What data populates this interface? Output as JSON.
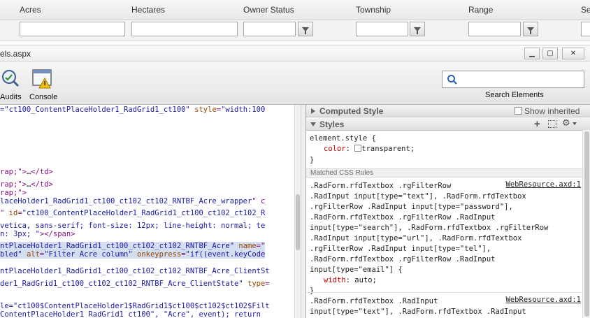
{
  "grid": {
    "columns": [
      "Acres",
      "Hectares",
      "Owner Status",
      "Township",
      "Range",
      "Se"
    ]
  },
  "devtools": {
    "title": "els.aspx",
    "window_buttons": [
      "minimize",
      "restore",
      "close"
    ],
    "toolbar": {
      "audits_label": "Audits",
      "console_label": "Console",
      "search_placeholder": "",
      "search_caption": "Search Elements"
    },
    "dom_lines": [
      {
        "parts": [
          [
            "v",
            "=\"ct100_ContentPlaceHolder1_RadGrid1_ct100\" "
          ],
          [
            "n",
            "style"
          ],
          [
            "t",
            "="
          ],
          [
            "v",
            "\"width:100"
          ]
        ]
      },
      {
        "parts": [
          [
            "t",
            "rap;\">"
          ],
          [
            "x",
            "…"
          ],
          [
            "t",
            "</td>"
          ]
        ]
      },
      {
        "parts": [
          [
            "t",
            "rap;\">"
          ],
          [
            "x",
            "…"
          ],
          [
            "t",
            "</td>"
          ]
        ]
      },
      {
        "parts": [
          [
            "t",
            "rap;\">"
          ]
        ]
      },
      {
        "parts": [
          [
            "v",
            "laceHolder1_RadGrid1_ct100_ct102_ct102_RNTBF_Acre_wrapper"
          ],
          [
            "t",
            "\" c"
          ]
        ]
      },
      {
        "parts": [
          [
            "t",
            "\" "
          ],
          [
            "n",
            "id"
          ],
          [
            "t",
            "="
          ],
          [
            "v",
            "\"ct100_ContentPlaceHolder1_RadGrid1_ct100_ct102_ct102_R"
          ]
        ]
      },
      {
        "parts": [
          [
            "v",
            "vetica, sans-serif; font-size: 12px; line-height: normal; te"
          ]
        ]
      },
      {
        "parts": [
          [
            "v",
            "n: 3px; \""
          ],
          [
            "t",
            "></span>"
          ]
        ]
      },
      {
        "parts": [
          [
            "v",
            "ntPlaceHolder1_RadGrid1_ct100_ct102_ct102_RNTBF_Acre\" "
          ],
          [
            "n",
            "name"
          ],
          [
            "t",
            "=\""
          ]
        ]
      },
      {
        "parts": [
          [
            "v",
            "bled\" "
          ],
          [
            "n",
            "alt"
          ],
          [
            "t",
            "="
          ],
          [
            "v",
            "\"Filter Acre column\" "
          ],
          [
            "n",
            "onkeypress"
          ],
          [
            "t",
            "="
          ],
          [
            "v",
            "\"if((event.keyCode"
          ]
        ]
      },
      {
        "parts": [
          [
            "v",
            "ntPlaceHolder1_RadGrid1_ct100_ct102_ct102_RNTBF_Acre_ClientSt"
          ]
        ]
      },
      {
        "parts": [
          [
            "v",
            "der1_RadGrid1_ct100_ct102_ct102_RNTBF_Acre_ClientState\" "
          ],
          [
            "n",
            "type"
          ],
          [
            "t",
            "="
          ]
        ]
      },
      {
        "parts": [
          [
            "v",
            "le=\"ct100$ContentPlaceHolder1$RadGrid1$ct100$ct102$ct102$Filt"
          ]
        ]
      },
      {
        "parts": [
          [
            "v",
            "ContentPlaceHolder1_RadGrid1_ct100\", \"Acre\", event); return "
          ]
        ]
      }
    ],
    "sidebar": {
      "computed_style_label": "Computed Style",
      "show_inherited_label": "Show inherited",
      "styles_label": "Styles",
      "element_style": {
        "selector": "element.style {",
        "property": "color",
        "value": "transparent;",
        "close": "}"
      },
      "matched_label": "Matched CSS Rules",
      "rule1": {
        "source": "WebResource.axd:1",
        "selector_lines": [
          ".RadForm.rfdTextbox .rgFilterRow",
          ".RadInput input[type=\"text\"], .RadForm.rfdTextbox",
          ".rgFilterRow .RadInput input[type=\"password\"],",
          ".RadForm.rfdTextbox .rgFilterRow .RadInput",
          "input[type=\"search\"], .RadForm.rfdTextbox .rgFilterRow",
          ".RadInput input[type=\"url\"], .RadForm.rfdTextbox",
          ".rgFilterRow .RadInput input[type=\"tel\"],",
          ".RadForm.rfdTextbox .rgFilterRow .RadInput",
          "input[type=\"email\"] {"
        ],
        "property": "width",
        "value": "auto;",
        "close": "}"
      },
      "rule2": {
        "source": "WebResource.axd:1",
        "selector_lines": [
          ".RadForm.rfdTextbox .RadInput",
          "input[type=\"text\"], .RadForm.rfdTextbox .RadInput"
        ]
      }
    }
  }
}
